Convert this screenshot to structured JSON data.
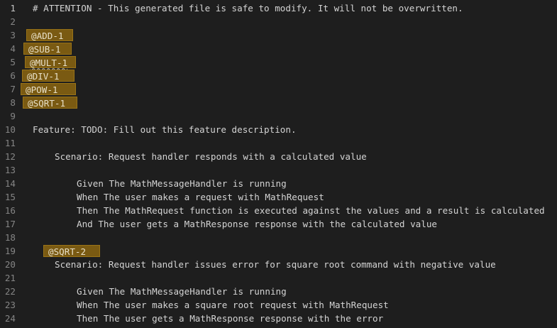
{
  "lines": [
    {
      "n": "1",
      "text": "# ATTENTION - This generated file is safe to modify. It will not be overwritten."
    },
    {
      "n": "2",
      "text": ""
    },
    {
      "n": "3",
      "text": "@ADD-1"
    },
    {
      "n": "4",
      "text": "@SUB-1"
    },
    {
      "n": "5",
      "text": "@MULT-1"
    },
    {
      "n": "6",
      "text": "@DIV-1"
    },
    {
      "n": "7",
      "text": "@POW-1"
    },
    {
      "n": "8",
      "text": "@SQRT-1"
    },
    {
      "n": "9",
      "text": ""
    },
    {
      "n": "10",
      "text": "Feature: TODO: Fill out this feature description."
    },
    {
      "n": "11",
      "text": ""
    },
    {
      "n": "12",
      "text": "Scenario: Request handler responds with a calculated value"
    },
    {
      "n": "13",
      "text": ""
    },
    {
      "n": "14",
      "text": "Given The MathMessageHandler is running"
    },
    {
      "n": "15",
      "text": "When The user makes a request with MathRequest"
    },
    {
      "n": "16",
      "text": "Then The MathRequest function is executed against the values and a result is calculated"
    },
    {
      "n": "17",
      "text": "And The user gets a MathResponse response with the calculated value"
    },
    {
      "n": "18",
      "text": ""
    },
    {
      "n": "19",
      "text": "@SQRT-2"
    },
    {
      "n": "20",
      "text": "Scenario: Request handler issues error for square root command with negative value"
    },
    {
      "n": "21",
      "text": ""
    },
    {
      "n": "22",
      "text": "Given The MathMessageHandler is running"
    },
    {
      "n": "23",
      "text": "When The user makes a square root request with MathRequest"
    },
    {
      "n": "24",
      "text": "Then The user gets a MathResponse response with the error"
    }
  ]
}
